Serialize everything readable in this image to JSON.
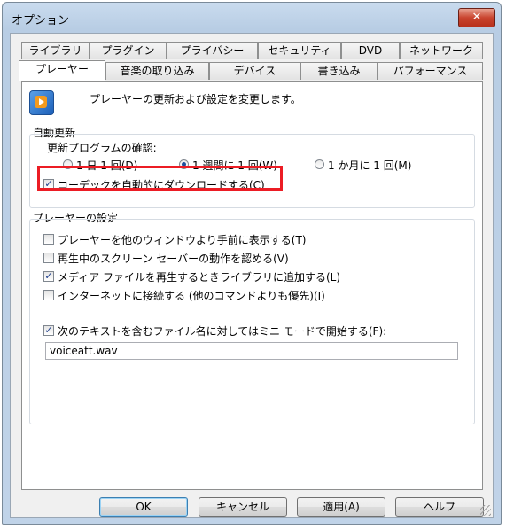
{
  "window": {
    "title": "オプション",
    "close_glyph": "✕"
  },
  "tabs_back": [
    "ライブラリ",
    "プラグイン",
    "プライバシー",
    "セキュリティ",
    "DVD",
    "ネットワーク"
  ],
  "tabs_front": [
    "プレーヤー",
    "音楽の取り込み",
    "デバイス",
    "書き込み",
    "パフォーマンス"
  ],
  "active_tab": "プレーヤー",
  "panel": {
    "description": "プレーヤーの更新および設定を変更します。",
    "auto_update": {
      "group_label": "自動更新",
      "check_label": "更新プログラムの確認:",
      "options": [
        "1 日 1 回(D)",
        "1 週間に 1 回(W)",
        "1 か月に 1 回(M)"
      ],
      "selected": "1 週間に 1 回(W)",
      "codec_checkbox": {
        "label": "コーデックを自動的にダウンロードする(C)",
        "checked": true
      }
    },
    "player_settings": {
      "group_label": "プレーヤーの設定",
      "checkboxes": [
        {
          "label": "プレーヤーを他のウィンドウより手前に表示する(T)",
          "checked": false
        },
        {
          "label": "再生中のスクリーン セーバーの動作を認める(V)",
          "checked": false
        },
        {
          "label": "メディア ファイルを再生するときライブラリに追加する(L)",
          "checked": true
        },
        {
          "label": "インターネットに接続する (他のコマンドよりも優先)(I)",
          "checked": false
        }
      ],
      "mini_mode": {
        "label": "次のテキストを含むファイル名に対してはミニ モードで開始する(F):",
        "checked": true
      },
      "mini_mode_text": "voiceatt.wav"
    }
  },
  "buttons": {
    "ok": "OK",
    "cancel": "キャンセル",
    "apply": "適用(A)",
    "help": "ヘルプ"
  },
  "colors": {
    "highlight": "#ec1c24",
    "accent": "#1d4f9c"
  }
}
